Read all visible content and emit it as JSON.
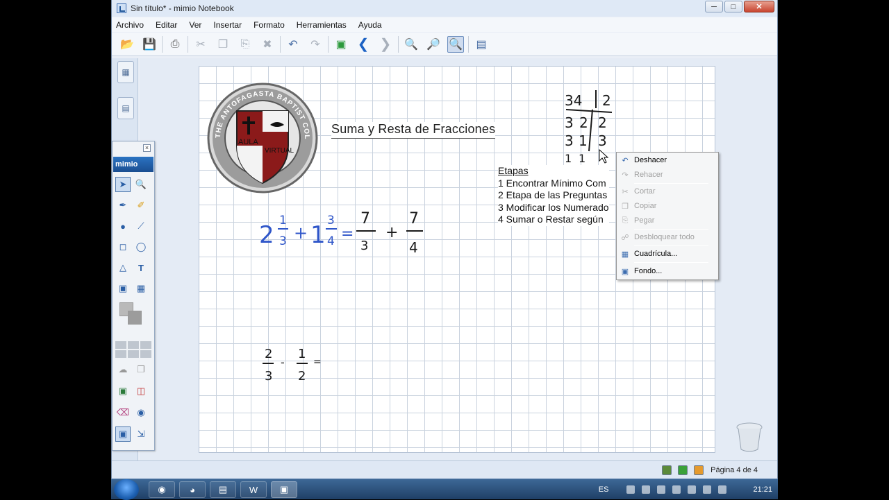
{
  "window": {
    "title": "Sin título* - mimio Notebook",
    "min_icon": "minimize-icon",
    "max_icon": "maximize-icon",
    "close_icon": "close-icon"
  },
  "menubar": {
    "items": [
      "Archivo",
      "Editar",
      "Ver",
      "Insertar",
      "Formato",
      "Herramientas",
      "Ayuda"
    ]
  },
  "page": {
    "title": "Suma y Resta de Fracciones",
    "logo_text": {
      "ring": "THE ANTOFAGASTA BAPTIST COLLEGE",
      "left": "AULA",
      "right": "VIRTUAL"
    },
    "etapas": {
      "heading": "Etapas",
      "lines": [
        "1 Encontrar Mínimo Com",
        "2 Etapa de las Preguntas",
        "3 Modificar los Numerado",
        "4 Sumar o Restar según"
      ]
    },
    "handwriting": {
      "mixed_1_whole": "2",
      "mixed_1_num": "1",
      "mixed_1_den": "3",
      "plus": "+",
      "mixed_2_whole": "1",
      "mixed_2_num": "3",
      "mixed_2_den": "4",
      "equals": "=",
      "result_1_num": "7",
      "result_1_den": "3",
      "result_2_num": "7",
      "result_2_den": "4",
      "sub_1_num": "2",
      "sub_1_den": "3",
      "minus": "-",
      "sub_2_num": "1",
      "sub_2_den": "2",
      "division": {
        "dividend": "34",
        "divisor": "2",
        "rows": [
          [
            "3",
            "2",
            "2"
          ],
          [
            "3",
            "1",
            "3"
          ],
          [
            "1",
            "1"
          ]
        ]
      }
    }
  },
  "palette": {
    "brand": "mimio"
  },
  "context_menu": {
    "items": [
      {
        "label": "Deshacer",
        "enabled": true,
        "icon": "undo-icon"
      },
      {
        "label": "Rehacer",
        "enabled": false,
        "icon": "redo-icon"
      },
      {
        "label": "Cortar",
        "enabled": false,
        "icon": "cut-icon"
      },
      {
        "label": "Copiar",
        "enabled": false,
        "icon": "copy-icon"
      },
      {
        "label": "Pegar",
        "enabled": false,
        "icon": "paste-icon"
      },
      {
        "label": "Desbloquear todo",
        "enabled": false,
        "icon": "lock-icon"
      },
      {
        "label": "Cuadrícula...",
        "enabled": true,
        "icon": "grid-icon"
      },
      {
        "label": "Fondo...",
        "enabled": true,
        "icon": "background-icon"
      }
    ]
  },
  "statusbar": {
    "page_indicator": "Página 4 de 4"
  },
  "taskbar": {
    "language": "ES",
    "clock": "21:21"
  },
  "colors": {
    "ink_blue": "#2f56c9",
    "ink_black": "#1a1a1a",
    "logo_red": "#8b1a1a"
  }
}
